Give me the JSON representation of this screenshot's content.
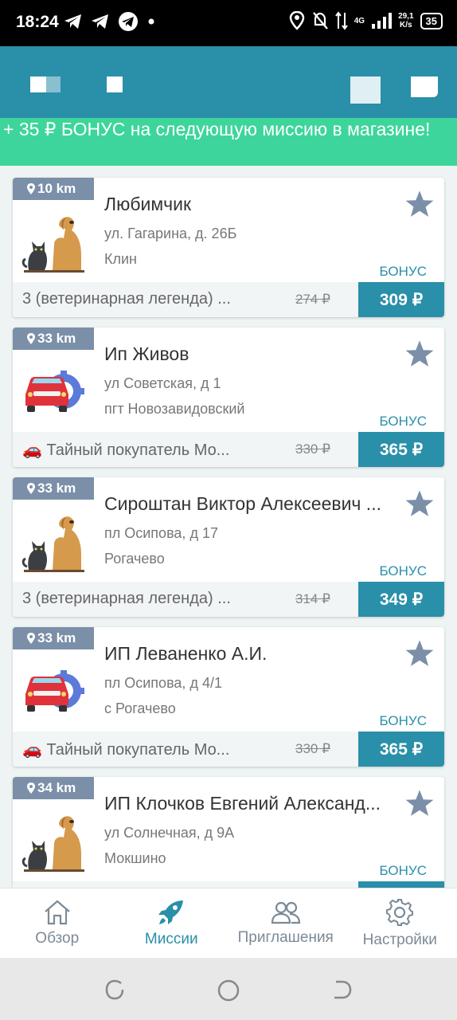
{
  "status_bar": {
    "time": "18:24",
    "network": "4G",
    "speed_top": "29,1",
    "speed_bottom": "K/s",
    "battery": "35"
  },
  "banner": {
    "text": "+ 35 ₽ БОНУС на следующую миссию в магазине!"
  },
  "missions": [
    {
      "distance": "10 km",
      "title": "Любимчик",
      "address": "ул. Гагарина, д. 26Б",
      "city": "Клин",
      "bonus_label": "БОНУС",
      "description": "3 (ветеринарная легенда) ...",
      "old_price": "274 ₽",
      "price": "309 ₽",
      "icon": "dog-cat-icon"
    },
    {
      "distance": "33 km",
      "title": "Ип Живов",
      "address": "ул Советская, д 1",
      "city": "пгт Новозавидовский",
      "bonus_label": "БОНУС",
      "description": "🚗 Тайный покупатель Мо...",
      "old_price": "330 ₽",
      "price": "365 ₽",
      "icon": "car-service-icon"
    },
    {
      "distance": "33 km",
      "title": "Сироштан Виктор Алексеевич ...",
      "address": "пл Осипова, д 17",
      "city": "Рогачево",
      "bonus_label": "БОНУС",
      "description": "3 (ветеринарная легенда) ...",
      "old_price": "314 ₽",
      "price": "349 ₽",
      "icon": "dog-cat-icon"
    },
    {
      "distance": "33 km",
      "title": "ИП Леваненко А.И.",
      "address": "пл Осипова, д 4/1",
      "city": "с Рогачево",
      "bonus_label": "БОНУС",
      "description": "🚗 Тайный покупатель Мо...",
      "old_price": "330 ₽",
      "price": "365 ₽",
      "icon": "car-service-icon"
    },
    {
      "distance": "34 km",
      "title": "ИП Клочков Евгений Александ...",
      "address": "ул Солнечная, д 9А",
      "city": "Мокшино",
      "bonus_label": "БОНУС",
      "description": "",
      "old_price": "",
      "price": "",
      "icon": "dog-cat-icon"
    }
  ],
  "bottom_nav": [
    {
      "label": "Обзор",
      "icon": "home-icon",
      "active": false
    },
    {
      "label": "Миссии",
      "icon": "rocket-icon",
      "active": true
    },
    {
      "label": "Приглашения",
      "icon": "people-icon",
      "active": false
    },
    {
      "label": "Настройки",
      "icon": "gear-icon",
      "active": false
    }
  ],
  "colors": {
    "primary": "#2a8fa9",
    "banner": "#3dd59b",
    "distance_badge": "#7b8fa9"
  }
}
